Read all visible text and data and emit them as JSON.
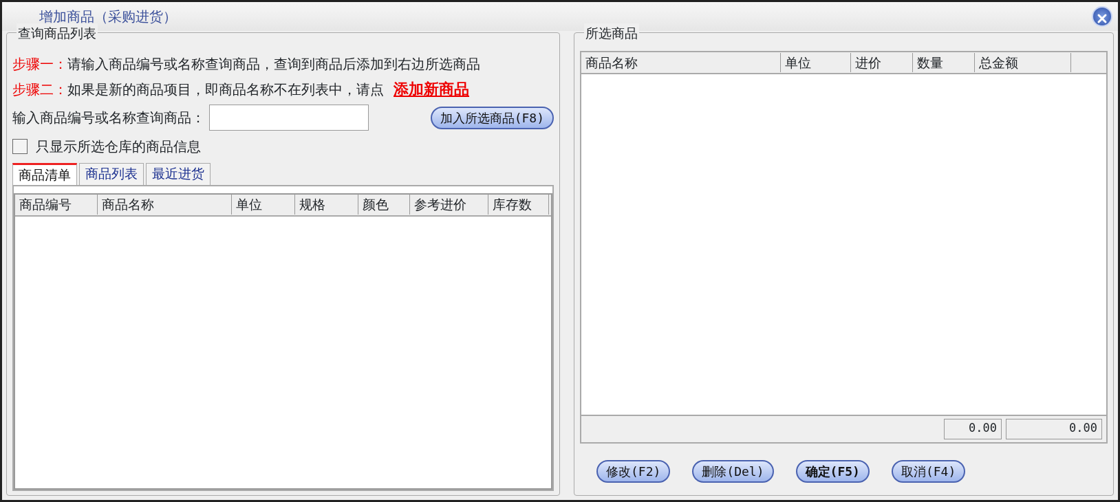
{
  "window": {
    "title": "增加商品（采购进货）"
  },
  "search_panel": {
    "title": "查询商品列表",
    "steps": [
      {
        "label": "步骤一：",
        "text": "请输入商品编号或名称查询商品，查询到商品后添加到右边所选商品"
      },
      {
        "label": "步骤二：",
        "text": "如果是新的商品项目，即商品名称不在列表中，请点",
        "link": "添加新商品"
      }
    ],
    "search_label": "输入商品编号或名称查询商品：",
    "add_button": "加入所选商品(F8)",
    "filter": {
      "label": "只显示所选仓库的商品信息",
      "checked": false
    },
    "tabs": [
      {
        "label": "商品清单",
        "selected": true
      },
      {
        "label": "商品列表",
        "selected": false
      },
      {
        "label": "最近进货",
        "selected": false
      }
    ],
    "table": {
      "columns": [
        "商品编号",
        "商品名称",
        "单位",
        "规格",
        "颜色",
        "参考进价",
        "库存数"
      ]
    }
  },
  "selected_panel": {
    "title": "所选商品",
    "table": {
      "columns": [
        "商品名称",
        "单位",
        "进价",
        "数量",
        "总金额"
      ]
    },
    "totals": [
      "0.00",
      "0.00"
    ]
  },
  "buttons": [
    {
      "label": "修改(F2)",
      "bold": false
    },
    {
      "label": "删除(Del)",
      "bold": false
    },
    {
      "label": "确定(F5)",
      "bold": true
    },
    {
      "label": "取消(F4)",
      "bold": false
    }
  ]
}
